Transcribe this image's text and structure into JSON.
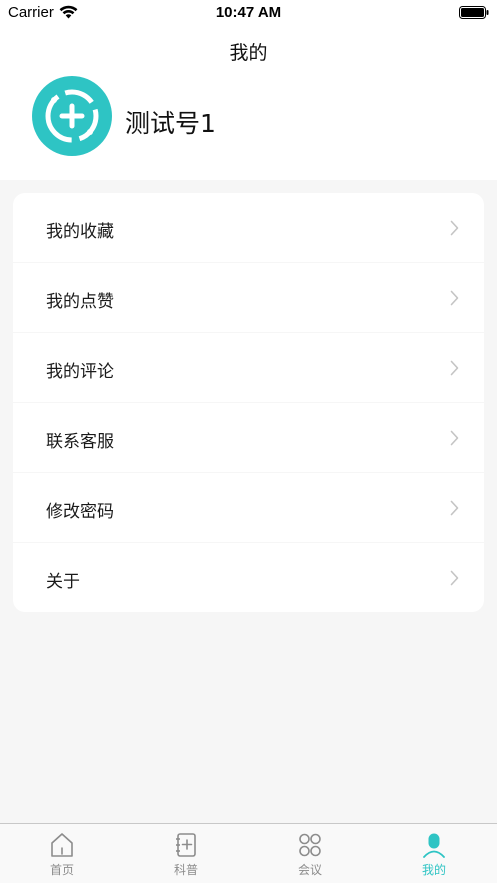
{
  "status_bar": {
    "carrier": "Carrier",
    "time": "10:47 AM"
  },
  "nav": {
    "title": "我的"
  },
  "profile": {
    "username": "测试号1",
    "avatar_icon": "add-circle-icon"
  },
  "colors": {
    "accent": "#2ec4c4",
    "background": "#f6f6f6",
    "inactive": "#8c8c8c"
  },
  "menu": {
    "items": [
      {
        "label": "我的收藏"
      },
      {
        "label": "我的点赞"
      },
      {
        "label": "我的评论"
      },
      {
        "label": "联系客服"
      },
      {
        "label": "修改密码"
      },
      {
        "label": "关于"
      }
    ]
  },
  "tab_bar": {
    "items": [
      {
        "label": "首页",
        "icon": "home-icon",
        "active": false
      },
      {
        "label": "科普",
        "icon": "notebook-icon",
        "active": false
      },
      {
        "label": "会议",
        "icon": "grid-circles-icon",
        "active": false
      },
      {
        "label": "我的",
        "icon": "person-icon",
        "active": true
      }
    ]
  }
}
